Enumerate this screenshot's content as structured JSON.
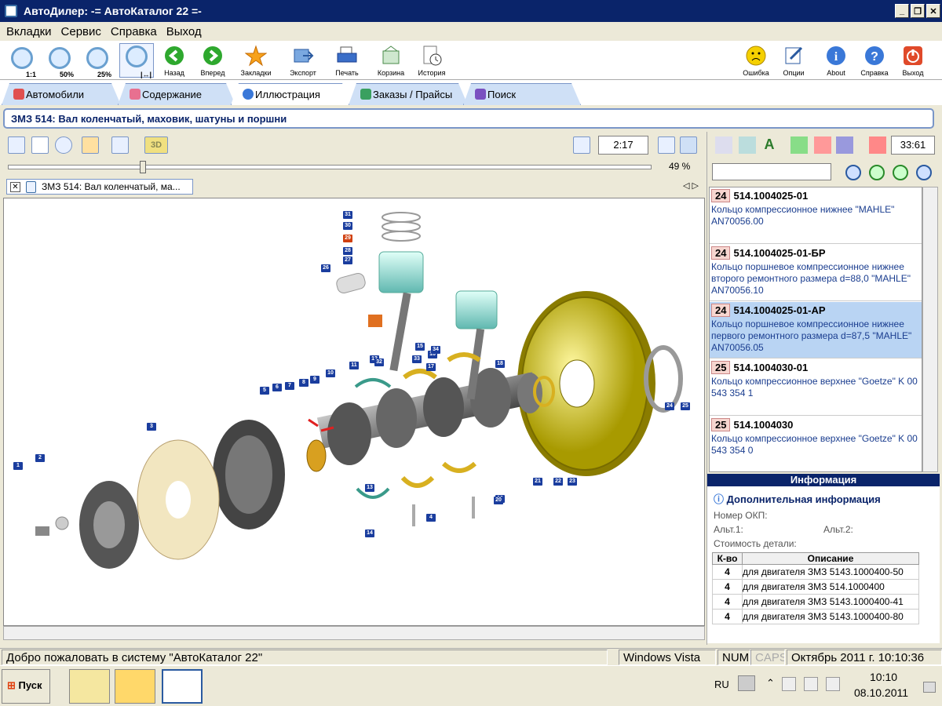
{
  "window": {
    "title": "АвтоДилер: -= АвтоКаталог 22 =-"
  },
  "menu": [
    "Вкладки",
    "Сервис",
    "Справка",
    "Выход"
  ],
  "toolbar": {
    "zoom": [
      "1:1",
      "50%",
      "25%",
      ""
    ],
    "buttons": [
      "Назад",
      "Вперед",
      "Закладки",
      "Экспорт",
      "Печать",
      "Корзина",
      "История"
    ],
    "right_buttons": [
      "Ошибка",
      "Опции",
      "About",
      "Справка",
      "Выход"
    ]
  },
  "tabs": [
    "Автомобили",
    "Содержание",
    "Иллюстрация",
    "Заказы / Прайсы",
    "Поиск"
  ],
  "header": "ЗМЗ 514: Вал коленчатый, маховик, шатуны и поршни",
  "illustration": {
    "counter": "2:17",
    "zoom_percent": "49 %",
    "zoom_level": 0.49,
    "doc_tab": "ЗМЗ 514: Вал коленчатый, ма...",
    "callouts": [
      "1",
      "2",
      "3",
      "4",
      "5",
      "6",
      "7",
      "8",
      "9",
      "10",
      "11",
      "12",
      "13",
      "14",
      "15",
      "16",
      "17",
      "18",
      "19",
      "20",
      "21",
      "22",
      "23",
      "24",
      "25",
      "26",
      "27",
      "28",
      "29",
      "30",
      "31",
      "32",
      "33",
      "34"
    ]
  },
  "parts_panel": {
    "counter": "33:61",
    "search_value": "",
    "items": [
      {
        "num": "24",
        "code": "514.1004025-01",
        "desc": "Кольцо компрессионное нижнее \"MAHLE\" AN70056.00",
        "selected": false
      },
      {
        "num": "24",
        "code": "514.1004025-01-БР",
        "desc": "Кольцо поршневое компрессионное нижнее второго ремонтного размера d=88,0 \"MAHLE\" AN70056.10",
        "selected": false
      },
      {
        "num": "24",
        "code": "514.1004025-01-АР",
        "desc": "Кольцо поршневое компрессионное нижнее первого ремонтного размера d=87,5 \"MAHLE\" AN70056.05",
        "selected": true
      },
      {
        "num": "25",
        "code": "514.1004030-01",
        "desc": "Кольцо компрессионное верхнее \"Goetze\" K 00 543 354 1",
        "selected": false
      },
      {
        "num": "25",
        "code": "514.1004030",
        "desc": "Кольцо компрессионное верхнее \"Goetze\" K 00 543 354 0",
        "selected": false
      }
    ]
  },
  "info": {
    "title": "Информация",
    "subtitle": "Дополнительная информация",
    "okp_label": "Номер ОКП:",
    "alt1_label": "Альт.1:",
    "alt2_label": "Альт.2:",
    "cost_label": "Стоимость детали:",
    "table_headers": [
      "К-во",
      "Описание"
    ],
    "rows": [
      {
        "qty": "4",
        "desc": "для двигателя ЗМЗ 5143.1000400-50"
      },
      {
        "qty": "4",
        "desc": "для двигателя ЗМЗ 514.1000400"
      },
      {
        "qty": "4",
        "desc": "для двигателя ЗМЗ 5143.1000400-41"
      },
      {
        "qty": "4",
        "desc": "для двигателя ЗМЗ 5143.1000400-80"
      }
    ]
  },
  "status": {
    "message": "Добро пожаловать в систему \"АвтоКаталог 22\"",
    "os": "Windows Vista",
    "num": "NUM",
    "caps": "CAPS",
    "datetime": "Октябрь 2011 г. 10:10:36"
  },
  "taskbar": {
    "start": "Пуск",
    "lang": "RU",
    "time": "10:10",
    "date": "08.10.2011"
  }
}
